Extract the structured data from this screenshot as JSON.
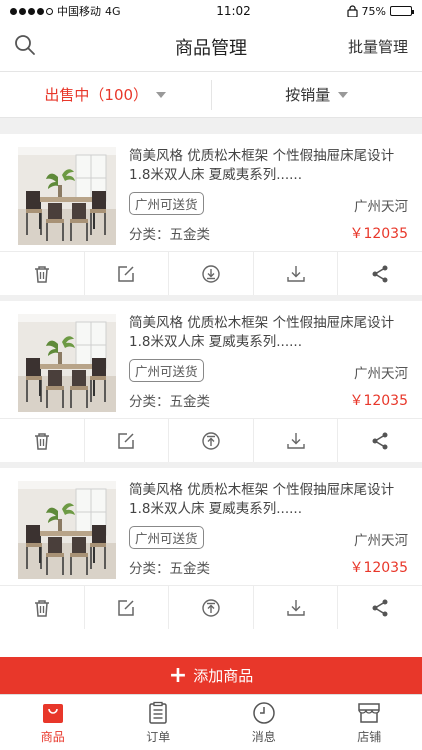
{
  "status_bar": {
    "carrier": "中国移动",
    "network": "4G",
    "time": "11:02",
    "battery": "75%",
    "battery_level": 0.75
  },
  "nav": {
    "title": "商品管理",
    "batch_label": "批量管理",
    "search_icon": "search-icon"
  },
  "filters": {
    "status_label": "出售中（100）",
    "sort_label": "按销量"
  },
  "products": [
    {
      "title": "简美风格 优质松木框架 个性假抽屉床尾设计 1.8米双人床 夏威夷系列......",
      "tag": "广州可送货",
      "location": "广州天河",
      "category": "分类：五金类",
      "price": "￥12035",
      "actions": [
        "delete-icon",
        "edit-icon",
        "take-down-icon",
        "download-icon",
        "share-icon"
      ]
    },
    {
      "title": "简美风格 优质松木框架 个性假抽屉床尾设计 1.8米双人床 夏威夷系列......",
      "tag": "广州可送货",
      "location": "广州天河",
      "category": "分类：五金类",
      "price": "￥12035",
      "actions": [
        "delete-icon",
        "edit-icon",
        "put-up-icon",
        "download-icon",
        "share-icon"
      ]
    },
    {
      "title": "简美风格 优质松木框架 个性假抽屉床尾设计 1.8米双人床 夏威夷系列......",
      "tag": "广州可送货",
      "location": "广州天河",
      "category": "分类：五金类",
      "price": "￥12035",
      "actions": [
        "delete-icon",
        "edit-icon",
        "put-up-icon",
        "download-icon",
        "share-icon"
      ]
    }
  ],
  "add_button": {
    "label": "添加商品"
  },
  "tabs": [
    {
      "label": "商品",
      "icon": "bag-icon",
      "active": true
    },
    {
      "label": "订单",
      "icon": "order-icon",
      "active": false
    },
    {
      "label": "消息",
      "icon": "clock-icon",
      "active": false
    },
    {
      "label": "店铺",
      "icon": "shop-icon",
      "active": false
    }
  ],
  "colors": {
    "accent": "#e8372a",
    "background_gap": "#f0f0f0",
    "text": "#333333"
  }
}
